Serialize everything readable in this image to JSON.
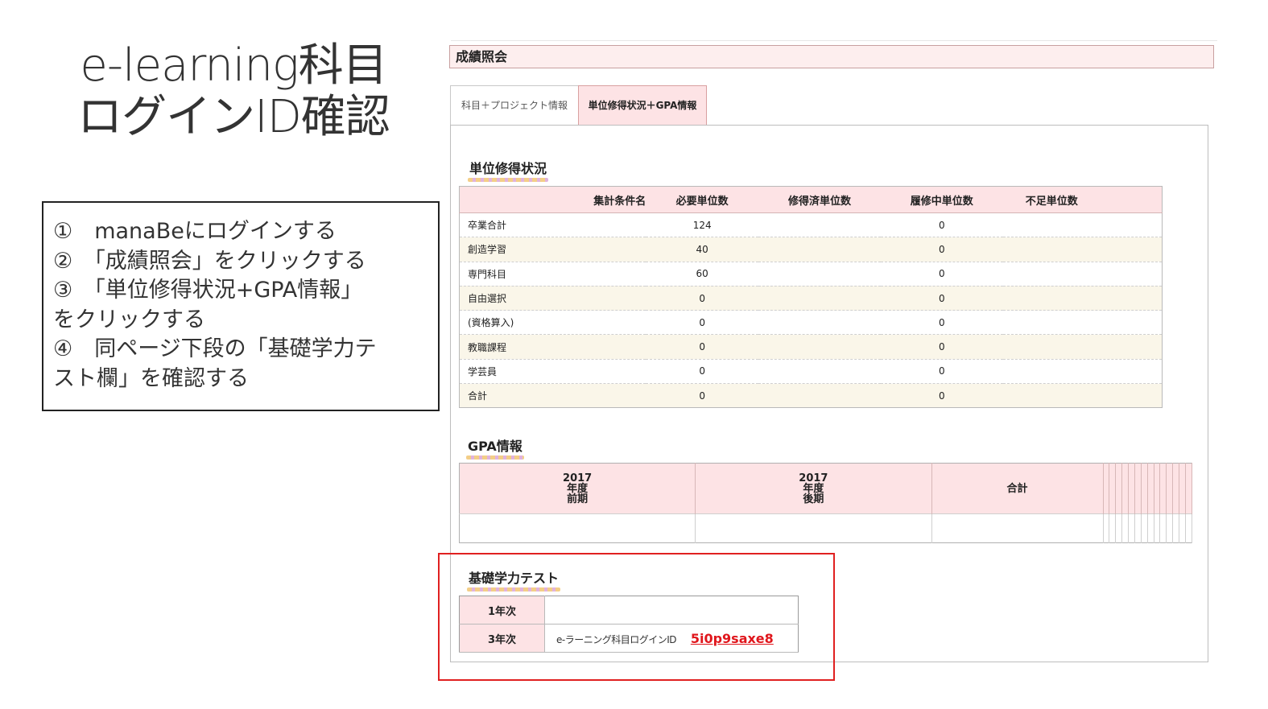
{
  "slide": {
    "title_line1": "e-learning科目",
    "title_line2": "ログインID確認",
    "steps": [
      "①　manaBeにログインする",
      "②　「成績照会」をクリックする",
      "③　「単位修得状況+GPA情報」",
      "をクリックする",
      "④　同ページ下段の「基礎学力テ",
      "スト欄」を確認する"
    ]
  },
  "screen": {
    "header": "成績照会",
    "tabs": [
      {
        "label": "科目＋プロジェクト情報",
        "active": false
      },
      {
        "label": "単位修得状況＋GPA情報",
        "active": true
      }
    ],
    "credit_section": {
      "title": "単位修得状況",
      "columns": [
        "集計条件名",
        "必要単位数",
        "修得済単位数",
        "履修中単位数",
        "不足単位数"
      ],
      "rows": [
        {
          "name": "卒業合計",
          "required": "124",
          "earned": "",
          "in_progress": "0",
          "shortage": ""
        },
        {
          "name": "創造学習",
          "required": "40",
          "earned": "",
          "in_progress": "0",
          "shortage": ""
        },
        {
          "name": "専門科目",
          "required": "60",
          "earned": "",
          "in_progress": "0",
          "shortage": ""
        },
        {
          "name": "自由選択",
          "required": "0",
          "earned": "",
          "in_progress": "0",
          "shortage": ""
        },
        {
          "name": "(資格算入)",
          "required": "0",
          "earned": "",
          "in_progress": "0",
          "shortage": ""
        },
        {
          "name": "教職課程",
          "required": "0",
          "earned": "",
          "in_progress": "0",
          "shortage": ""
        },
        {
          "name": "学芸員",
          "required": "0",
          "earned": "",
          "in_progress": "0",
          "shortage": ""
        },
        {
          "name": "合計",
          "required": "0",
          "earned": "",
          "in_progress": "0",
          "shortage": ""
        }
      ]
    },
    "gpa_section": {
      "title": "GPA情報",
      "headers": [
        {
          "line1": "2017",
          "line2": "年度",
          "line3": "前期"
        },
        {
          "line1": "2017",
          "line2": "年度",
          "line3": "後期"
        },
        {
          "line1": "合計",
          "line2": "",
          "line3": ""
        }
      ],
      "empty_columns": 14
    },
    "basic_test_section": {
      "title": "基礎学力テスト",
      "rows": [
        {
          "year": "1年次",
          "label": "",
          "login_id": ""
        },
        {
          "year": "3年次",
          "label": "e-ラーニング科目ログインID",
          "login_id": "5i0p9saxe8"
        }
      ]
    }
  },
  "colors": {
    "accent_pink": "#fde3e5",
    "row_alt": "#faf6e9",
    "highlight_red": "#e02020",
    "id_red": "#e0161c"
  }
}
